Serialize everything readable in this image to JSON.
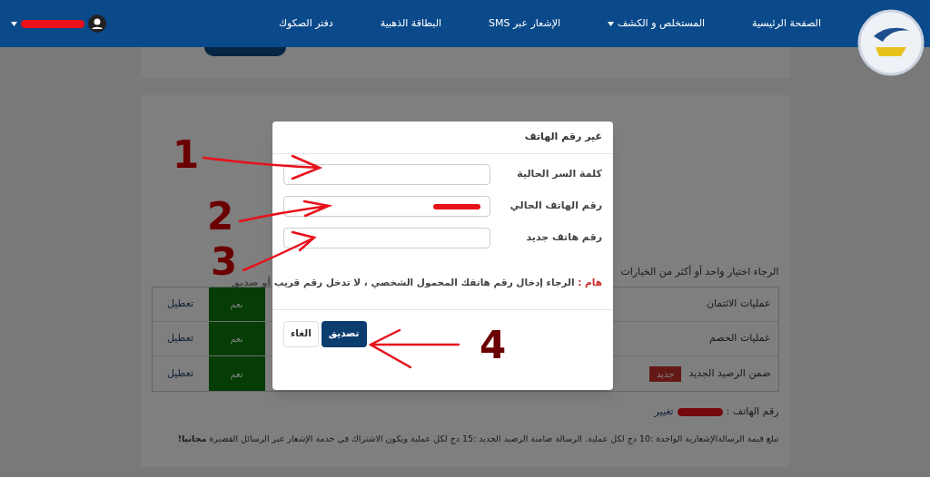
{
  "nav": {
    "items": [
      {
        "label": "الصفحة الرئيسية",
        "dropdown": false
      },
      {
        "label": "المستخلص و الكشف",
        "dropdown": true
      },
      {
        "label": "الإشعار عبر SMS",
        "dropdown": false
      },
      {
        "label": "البطاقة الذهبية",
        "dropdown": false
      },
      {
        "label": "دفتر الصكوك",
        "dropdown": false
      }
    ]
  },
  "page": {
    "instructions": "الرجاء اختيار واحد أو أكثر من الخيارات",
    "options": [
      {
        "label": "عمليات الائتمان",
        "status": "نعم",
        "action": "تعطيل"
      },
      {
        "label": "عمليات الخصم",
        "status": "نعم",
        "action": "تعطيل"
      },
      {
        "label": "ضمن الرصيد الجديد",
        "badge": "جديد",
        "status": "نعم",
        "action": "تعطيل"
      }
    ],
    "phone_label": "رقم الهاتف :",
    "phone_change": "تغيير",
    "note": "تبلغ قيمة الرسالةالإشعارية الواحدة :10 دج لكل عملية. الرسالة ضامنة الرصيد الجديد :15 دج لكل عملية ويكون الاشتراك في خدمة الإشعار عبر الرسائل القصيرة **مجانيا!**"
  },
  "dialog": {
    "title": "غير رقم الهاتف",
    "fields": [
      {
        "label": "كلمة السر الحالية",
        "redacted": false
      },
      {
        "label": "رقم الهاتف الحالي",
        "redacted": true
      },
      {
        "label": "رقم هاتف جديد",
        "redacted": false
      }
    ],
    "warning_label": "هام :",
    "warning": "الرجاء إدخال رقم هاتفك المحمول الشخصي ، لا تدخل رقم قريب أو صديق",
    "confirm": "تصديق",
    "cancel": "الغاء"
  },
  "annotations": [
    {
      "label": "1"
    },
    {
      "label": "2"
    },
    {
      "label": "3"
    },
    {
      "label": "4"
    }
  ]
}
